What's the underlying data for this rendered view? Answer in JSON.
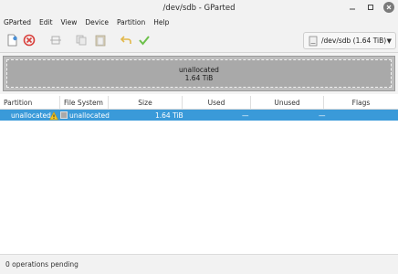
{
  "window": {
    "title": "/dev/sdb - GParted"
  },
  "menubar": {
    "items": [
      "GParted",
      "Edit",
      "View",
      "Device",
      "Partition",
      "Help"
    ]
  },
  "toolbar": {
    "icons": [
      "new-partition-icon",
      "delete-icon",
      "resize-move-icon",
      "copy-icon",
      "paste-icon",
      "undo-icon",
      "apply-icon"
    ],
    "device": "/dev/sdb (1.64 TiB)"
  },
  "disk_map": {
    "label": "unallocated",
    "size": "1.64 TiB",
    "fill_color": "#a9a9a9"
  },
  "table": {
    "columns": [
      "Partition",
      "File System",
      "Size",
      "Used",
      "Unused",
      "Flags"
    ],
    "rows": [
      {
        "partition": "unallocated",
        "file_system": "unallocated",
        "size": "1.64 TiB",
        "used": "—",
        "unused": "—",
        "flags": ""
      }
    ],
    "selection_color": "#3a9ad9"
  },
  "status": {
    "text": "0 operations pending"
  }
}
